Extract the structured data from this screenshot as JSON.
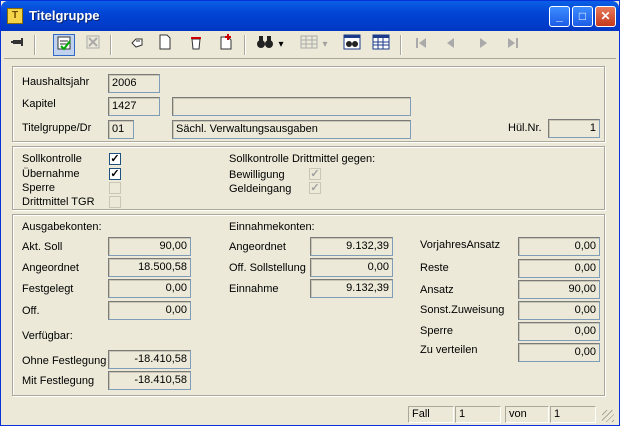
{
  "window": {
    "title": "Titelgruppe",
    "title_icon_glyph": "T",
    "minimize": "_",
    "maximize": "□",
    "close": "✕"
  },
  "toolbar": {
    "icons": [
      "pin-icon",
      "checklist-icon",
      "delete-list-icon",
      "hand-icon",
      "new-page-icon",
      "recycle-icon",
      "add-page-icon",
      "binoculars-icon",
      "grid-icon",
      "binoculars-list-icon",
      "calendar-list-icon",
      "first-icon",
      "prev-icon",
      "next-icon",
      "last-icon"
    ],
    "dropdown_glyph": "▾"
  },
  "header": {
    "haushaltsjahr_label": "Haushaltsjahr",
    "haushaltsjahr_value": "2006",
    "kapitel_label": "Kapitel",
    "kapitel_value": "1427",
    "kapitel_text": "",
    "titelgruppe_label": "Titelgruppe/Dr",
    "titelgruppe_value": "01",
    "titelgruppe_text": "Sächl. Verwaltungsausgaben",
    "huel_label": "Hül.Nr.",
    "huel_value": "1"
  },
  "controls": {
    "sollkontrolle": "Sollkontrolle",
    "uebernahme": "Übernahme",
    "sperre": "Sperre",
    "drittmittel": "Drittmittel TGR",
    "dritt_heading": "Sollkontrolle Drittmittel gegen:",
    "bewilligung": "Bewilligung",
    "geldeingang": "Geldeingang",
    "check_glyph": "✓"
  },
  "ausgabe": {
    "heading": "Ausgabekonten:",
    "akt_soll_label": "Akt. Soll",
    "akt_soll": "90,00",
    "angeordnet_label": "Angeordnet",
    "angeordnet": "18.500,58",
    "festgelegt_label": "Festgelegt",
    "festgelegt": "0,00",
    "off_label": "Off.",
    "off": "0,00",
    "verfuegbar": "Verfügbar:",
    "ohne_label": "Ohne Festlegung",
    "ohne": "-18.410,58",
    "mit_label": "Mit Festlegung",
    "mit": "-18.410,58"
  },
  "einnahme": {
    "heading": "Einnahmekonten:",
    "angeordnet_label": "Angeordnet",
    "angeordnet": "9.132,39",
    "off_label": "Off. Sollstellung",
    "off": "0,00",
    "einnahme_label": "Einnahme",
    "einnahme": "9.132,39"
  },
  "right": {
    "vorjahr_label": "VorjahresAnsatz",
    "vorjahr": "0,00",
    "reste_label": "Reste",
    "reste": "0,00",
    "ansatz_label": "Ansatz",
    "ansatz": "90,00",
    "sonst_label": "Sonst.Zuweisung",
    "sonst": "0,00",
    "sperre_label": "Sperre",
    "sperre": "0,00",
    "zu_label": "Zu verteilen",
    "zu": "0,00"
  },
  "status": {
    "fall_label": "Fall",
    "fall_value": "1",
    "von_label": "von",
    "von_value": "1"
  }
}
